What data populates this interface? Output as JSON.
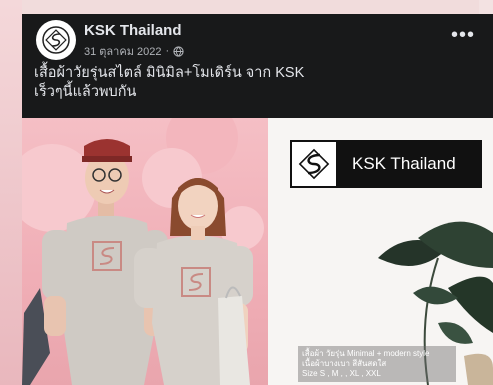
{
  "post": {
    "page_name": "KSK Thailand",
    "date": "31 ตุลาคม 2022",
    "separator": "·",
    "more_label": "•••",
    "caption_line1": "เสื้อผ้าวัยรุ่นสไตล์ มินิมิล+โมเดิร์น จาก KSK",
    "caption_line2": "เร็วๆนี้แล้วพบกัน"
  },
  "image": {
    "brand_text": "KSK Thailand",
    "info_line1": "เสื้อผ้า วัยรุ่น Minimal + modern style",
    "info_line2": "เนื้อผ้าบางเบา สีสันสดใส",
    "info_line3": "Size S , M , , XL , XXL"
  },
  "colors": {
    "card_bg": "#18191a",
    "text_primary": "#e4e6eb",
    "text_secondary": "#b0b3b8",
    "photo_pink": "#f0aeb6"
  },
  "icons": [
    "ksk-logo-icon",
    "globe-icon",
    "more-options-icon",
    "leaf-icon"
  ]
}
